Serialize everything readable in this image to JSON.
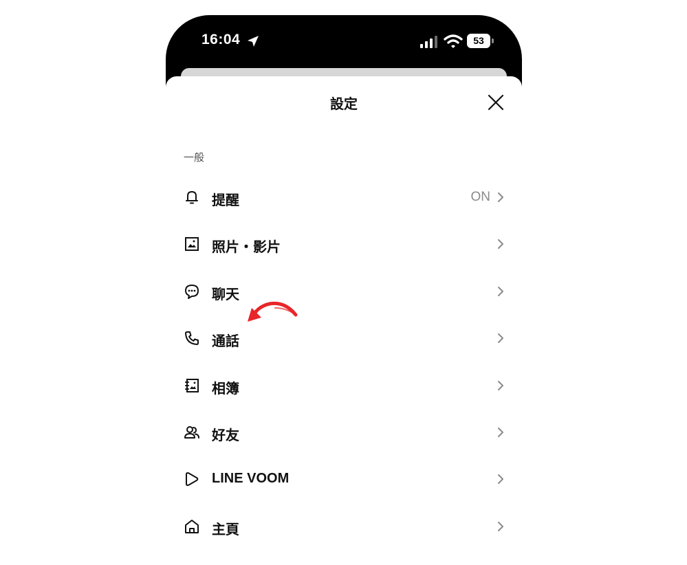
{
  "status_bar": {
    "time": "16:04",
    "battery": "53",
    "icons": [
      "location-arrow-icon",
      "cellular-signal-icon",
      "wifi-icon",
      "battery-icon"
    ]
  },
  "sheet": {
    "title": "設定",
    "close_icon": "close-icon",
    "section_label": "一般"
  },
  "items": [
    {
      "label": "提醒",
      "value": "ON",
      "icon": "bell-icon"
    },
    {
      "label": "照片・影片",
      "value": "",
      "icon": "photo-icon"
    },
    {
      "label": "聊天",
      "value": "",
      "icon": "chat-bubble-icon"
    },
    {
      "label": "通話",
      "value": "",
      "icon": "phone-icon"
    },
    {
      "label": "相簿",
      "value": "",
      "icon": "album-icon"
    },
    {
      "label": "好友",
      "value": "",
      "icon": "friends-icon"
    },
    {
      "label": "LINE VOOM",
      "value": "",
      "icon": "voom-play-icon"
    },
    {
      "label": "主頁",
      "value": "",
      "icon": "home-icon"
    }
  ],
  "colors": {
    "annotation_arrow": "#e8262a",
    "phone_frame": "#000000",
    "secondary_text": "#8a8a8a"
  },
  "annotation": {
    "icon": "red-curved-arrow-icon",
    "points_to": "通話"
  }
}
